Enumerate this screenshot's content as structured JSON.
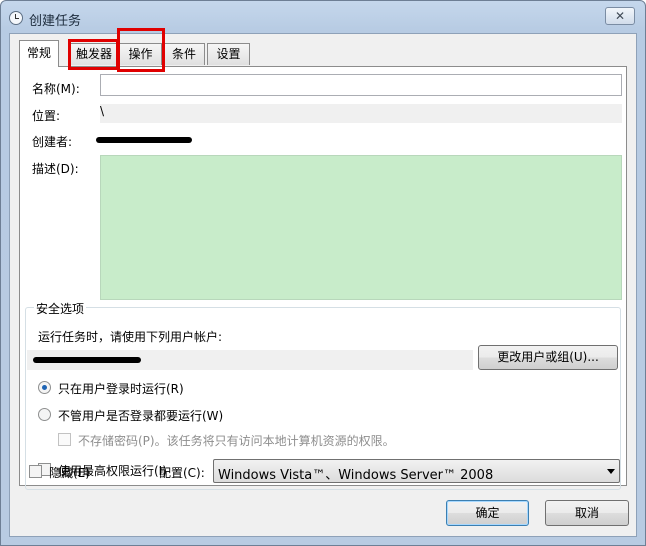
{
  "window": {
    "title": "创建任务",
    "close_glyph": "✕"
  },
  "tabs": [
    {
      "label": "常规"
    },
    {
      "label": "触发器"
    },
    {
      "label": "操作"
    },
    {
      "label": "条件"
    },
    {
      "label": "设置"
    }
  ],
  "general": {
    "name_label": "名称(M):",
    "name_value": "",
    "location_label": "位置:",
    "location_value": "\\",
    "author_label": "创建者:",
    "description_label": "描述(D):",
    "description_value": ""
  },
  "security": {
    "group_title": "安全选项",
    "run_as_prompt": "运行任务时，请使用下列用户帐户:",
    "change_user_button": "更改用户或组(U)...",
    "radio_logged_on": "只在用户登录时运行(R)",
    "radio_whether": "不管用户是否登录都要运行(W)",
    "no_store_password": "不存储密码(P)。该任务将只有访问本地计算机资源的权限。",
    "highest_privileges": "使用最高权限运行(I)"
  },
  "footer": {
    "hidden_label": "隐藏(E)",
    "configure_label": "配置(C):",
    "configure_value": "Windows Vista™、Windows Server™ 2008"
  },
  "buttons": {
    "ok": "确定",
    "cancel": "取消"
  },
  "colors": {
    "description_bg": "#c8ecca",
    "highlight_box": "#e00000"
  }
}
